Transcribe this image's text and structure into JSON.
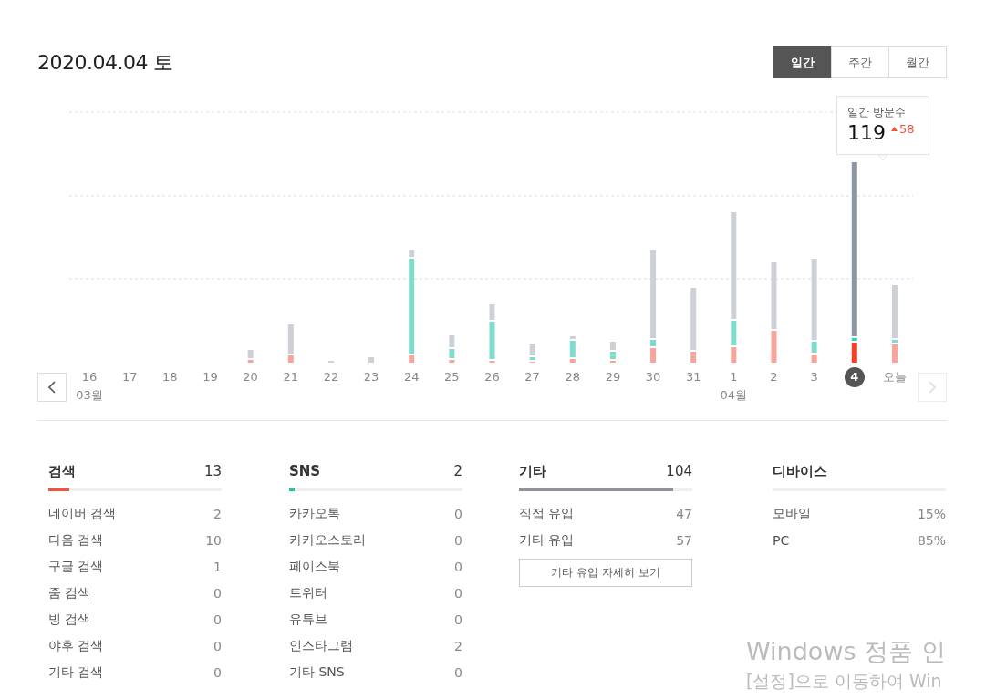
{
  "date_title": "2020.04.04 토",
  "period_tabs": [
    {
      "label": "일간",
      "selected": true
    },
    {
      "label": "주간",
      "selected": false
    },
    {
      "label": "월간",
      "selected": false
    }
  ],
  "tooltip": {
    "label": "일간 방문수",
    "value": "119",
    "change": "58"
  },
  "days": [
    {
      "label": "16",
      "selected": false,
      "month": "03월"
    },
    {
      "label": "17",
      "selected": false
    },
    {
      "label": "18",
      "selected": false
    },
    {
      "label": "19",
      "selected": false
    },
    {
      "label": "20",
      "selected": false
    },
    {
      "label": "21",
      "selected": false
    },
    {
      "label": "22",
      "selected": false
    },
    {
      "label": "23",
      "selected": false
    },
    {
      "label": "24",
      "selected": false
    },
    {
      "label": "25",
      "selected": false
    },
    {
      "label": "26",
      "selected": false
    },
    {
      "label": "27",
      "selected": false
    },
    {
      "label": "28",
      "selected": false
    },
    {
      "label": "29",
      "selected": false
    },
    {
      "label": "30",
      "selected": false
    },
    {
      "label": "31",
      "selected": false
    },
    {
      "label": "1",
      "selected": false,
      "month": "04월"
    },
    {
      "label": "2",
      "selected": false
    },
    {
      "label": "3",
      "selected": false
    },
    {
      "label": "4",
      "selected": true
    },
    {
      "label": "오늘",
      "selected": false
    }
  ],
  "next_disabled": true,
  "groups": [
    {
      "title": "검색",
      "total": "13",
      "level": 0.12,
      "color": "#f2533f",
      "rows": [
        {
          "label": "네이버 검색",
          "value": "2"
        },
        {
          "label": "다음 검색",
          "value": "10"
        },
        {
          "label": "구글 검색",
          "value": "1"
        },
        {
          "label": "줌 검색",
          "value": "0"
        },
        {
          "label": "빙 검색",
          "value": "0"
        },
        {
          "label": "야후 검색",
          "value": "0"
        },
        {
          "label": "기타 검색",
          "value": "0"
        }
      ]
    },
    {
      "title": "SNS",
      "total": "2",
      "level": 0.03,
      "color": "#1fc8a8",
      "rows": [
        {
          "label": "카카오톡",
          "value": "0"
        },
        {
          "label": "카카오스토리",
          "value": "0"
        },
        {
          "label": "페이스북",
          "value": "0"
        },
        {
          "label": "트위터",
          "value": "0"
        },
        {
          "label": "유튜브",
          "value": "0"
        },
        {
          "label": "인스타그램",
          "value": "2"
        },
        {
          "label": "기타 SNS",
          "value": "0"
        }
      ]
    },
    {
      "title": "기타",
      "total": "104",
      "level": 0.89,
      "color": "#8e939b",
      "rows": [
        {
          "label": "직접 유입",
          "value": "47"
        },
        {
          "label": "기타 유입",
          "value": "57"
        }
      ],
      "button": "기타 유입 자세히 보기"
    },
    {
      "title": "디바이스",
      "rows": [
        {
          "label": "모바일",
          "value": "15%"
        },
        {
          "label": "PC",
          "value": "85%"
        }
      ]
    }
  ],
  "windows_notice": {
    "title": "Windows 정품 인",
    "subtitle": "[설정]으로 이동하여 Win"
  }
}
